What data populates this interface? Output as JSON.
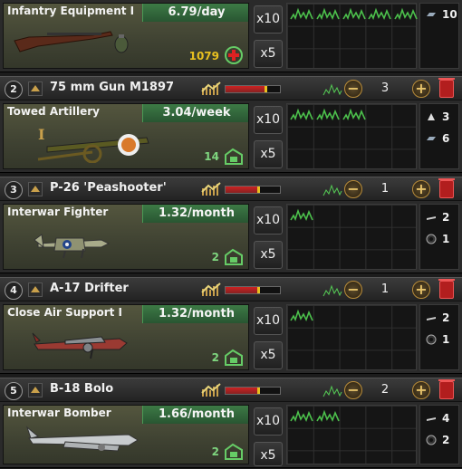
{
  "lines": [
    {
      "type_name": "Infantry Equipment I",
      "rate": "6.79/day",
      "amount": "1079",
      "amount_color": "#e8c020",
      "art": "rifle-art",
      "resources": [
        {
          "icon": "steel-icon",
          "value": "10"
        }
      ],
      "buttons": {
        "x10": "x10",
        "x5": "x5"
      }
    },
    {
      "priority": "2",
      "name": "75 mm Gun M1897",
      "factories": "3",
      "efficiency": 0.73,
      "type_name": "Towed Artillery",
      "rate": "3.04/week",
      "amount": "14",
      "amount_color": "#7fd67f",
      "art": "artillery-art",
      "resources": [
        {
          "icon": "tungsten-icon",
          "value": "3"
        },
        {
          "icon": "steel-icon",
          "value": "6"
        }
      ],
      "buttons": {
        "x10": "x10",
        "x5": "x5"
      }
    },
    {
      "priority": "3",
      "name": "P-26 'Peashooter'",
      "factories": "1",
      "efficiency": 0.6,
      "type_name": "Interwar Fighter",
      "rate": "1.32/month",
      "amount": "2",
      "amount_color": "#7fd67f",
      "art": "fighter-art",
      "resources": [
        {
          "icon": "aluminium-icon",
          "value": "2"
        },
        {
          "icon": "rubber-icon",
          "value": "1"
        }
      ],
      "buttons": {
        "x10": "x10",
        "x5": "x5"
      }
    },
    {
      "priority": "4",
      "name": "A-17 Drifter",
      "factories": "1",
      "efficiency": 0.6,
      "type_name": "Close Air Support I",
      "rate": "1.32/month",
      "amount": "2",
      "amount_color": "#7fd67f",
      "art": "cas-art",
      "resources": [
        {
          "icon": "aluminium-icon",
          "value": "2"
        },
        {
          "icon": "rubber-icon",
          "value": "1"
        }
      ],
      "buttons": {
        "x10": "x10",
        "x5": "x5"
      }
    },
    {
      "priority": "5",
      "name": "B-18 Bolo",
      "factories": "2",
      "efficiency": 0.6,
      "type_name": "Interwar Bomber",
      "rate": "1.66/month",
      "amount": "2",
      "amount_color": "#7fd67f",
      "art": "bomber-art",
      "resources": [
        {
          "icon": "aluminium-icon",
          "value": "4"
        },
        {
          "icon": "rubber-icon",
          "value": "2"
        }
      ],
      "buttons": {
        "x10": "x10",
        "x5": "x5"
      }
    }
  ]
}
